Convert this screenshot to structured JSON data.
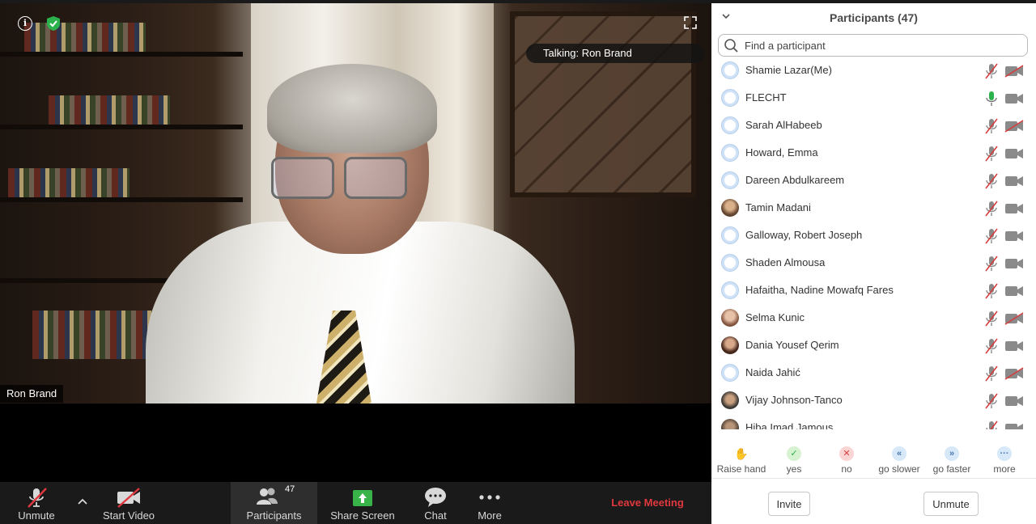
{
  "video": {
    "talking_label": "Talking: Ron Brand",
    "speaker_name": "Ron Brand"
  },
  "toolbar": {
    "unmute_label": "Unmute",
    "start_video_label": "Start Video",
    "participants_label": "Participants",
    "participants_count": "47",
    "share_screen_label": "Share Screen",
    "chat_label": "Chat",
    "more_label": "More",
    "leave_label": "Leave Meeting"
  },
  "panel": {
    "title": "Participants (47)",
    "search_placeholder": "Find a participant",
    "participants": [
      {
        "name": "Shamie Lazar(Me)",
        "avatar": "default",
        "mic": "muted",
        "video": "off"
      },
      {
        "name": "FLECHT",
        "avatar": "default",
        "mic": "on",
        "video": "on"
      },
      {
        "name": "Sarah AlHabeeb",
        "avatar": "default",
        "mic": "muted",
        "video": "off"
      },
      {
        "name": "Howard, Emma",
        "avatar": "default",
        "mic": "muted",
        "video": "on"
      },
      {
        "name": "Dareen Abdulkareem",
        "avatar": "default",
        "mic": "muted",
        "video": "on"
      },
      {
        "name": "Tamin Madani",
        "avatar": "photo1",
        "mic": "muted",
        "video": "on"
      },
      {
        "name": "Galloway, Robert Joseph",
        "avatar": "default",
        "mic": "muted",
        "video": "on"
      },
      {
        "name": "Shaden Almousa",
        "avatar": "default",
        "mic": "muted",
        "video": "on"
      },
      {
        "name": "Hafaitha, Nadine Mowafq Fares",
        "avatar": "default",
        "mic": "muted",
        "video": "on"
      },
      {
        "name": "Selma Kunic",
        "avatar": "photo2",
        "mic": "muted",
        "video": "off"
      },
      {
        "name": "Dania Yousef Qerim",
        "avatar": "photo3",
        "mic": "muted",
        "video": "on"
      },
      {
        "name": "Naida Jahić",
        "avatar": "default",
        "mic": "muted",
        "video": "off"
      },
      {
        "name": "Vijay Johnson-Tanco",
        "avatar": "photo4",
        "mic": "muted",
        "video": "on"
      },
      {
        "name": "Hiba Imad Jamous",
        "avatar": "photo5",
        "mic": "muted",
        "video": "on"
      }
    ],
    "reactions": {
      "raise_hand": "Raise hand",
      "yes": "yes",
      "no": "no",
      "go_slower": "go slower",
      "go_faster": "go faster",
      "more": "more"
    },
    "invite_label": "Invite",
    "unmute_label": "Unmute"
  },
  "colors": {
    "leave": "#e0383e",
    "mic_on": "#2bb24c",
    "muted_slash": "#d53d3d",
    "toolbar_bg": "#1a1a1a",
    "share_green": "#37b34a"
  }
}
